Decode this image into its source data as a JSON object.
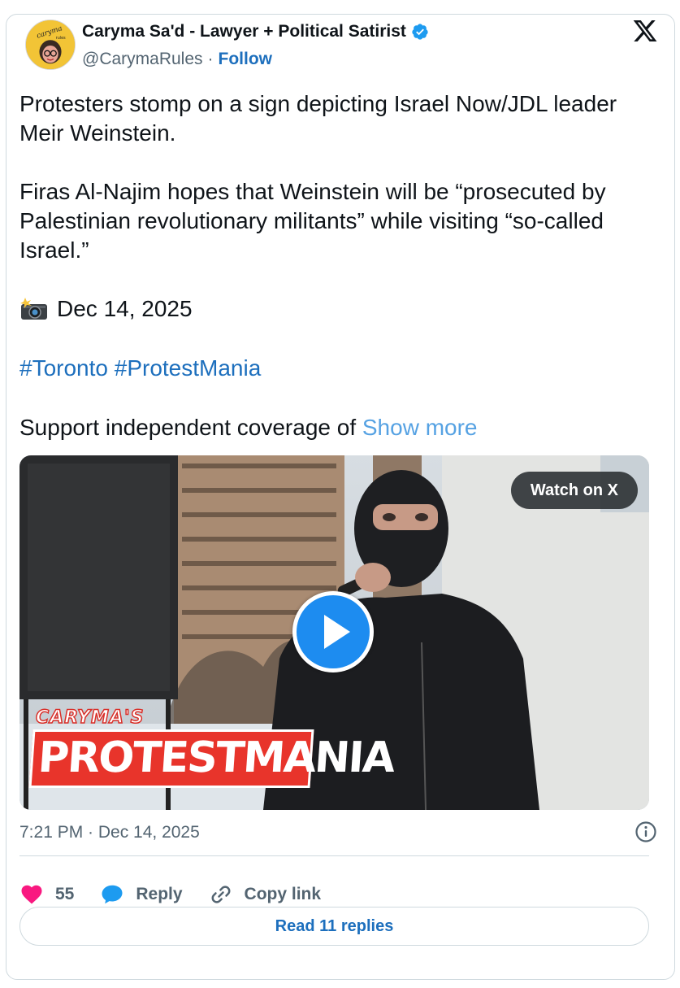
{
  "author": {
    "name": "Caryma Sa'd - Lawyer + Political Satirist",
    "handle": "@CarymaRules",
    "separator": "·",
    "follow_label": "Follow",
    "avatar_text": "caryma rules"
  },
  "tweet": {
    "paragraph1": "Protesters stomp on a sign depicting Israel Now/JDL leader Meir Weinstein.",
    "paragraph2": "Firas Al-Najim hopes that Weinstein will be “prosecuted by Palestinian revolutionary militants” while visiting “so-called Israel.”",
    "date_line": "Dec 14, 2025",
    "hashtags": [
      "#Toronto",
      "#ProtestMania"
    ],
    "support_text": "Support independent coverage of ",
    "show_more": "Show more"
  },
  "video": {
    "watch_label": "Watch on X",
    "brand_small": "CARYMA'S",
    "brand_big": "PROTESTMANIA"
  },
  "footer": {
    "timestamp": "7:21 PM · Dec 14, 2025",
    "likes": "55",
    "reply_label": "Reply",
    "copy_label": "Copy link",
    "read_replies": "Read 11 replies"
  },
  "icons": {
    "verified": "verified-badge-icon",
    "x": "x-logo-icon",
    "camera": "camera-flash-icon",
    "info": "info-icon",
    "heart": "heart-icon",
    "reply": "reply-bubble-icon",
    "link": "link-icon",
    "play": "play-icon"
  },
  "colors": {
    "link": "#1d6fbd",
    "show_more": "#56a2e3",
    "heart": "#f91880",
    "reply_bubble": "#1d9bf0",
    "muted": "#536471",
    "border": "#cfd9de",
    "brand_red": "#e8342b"
  }
}
